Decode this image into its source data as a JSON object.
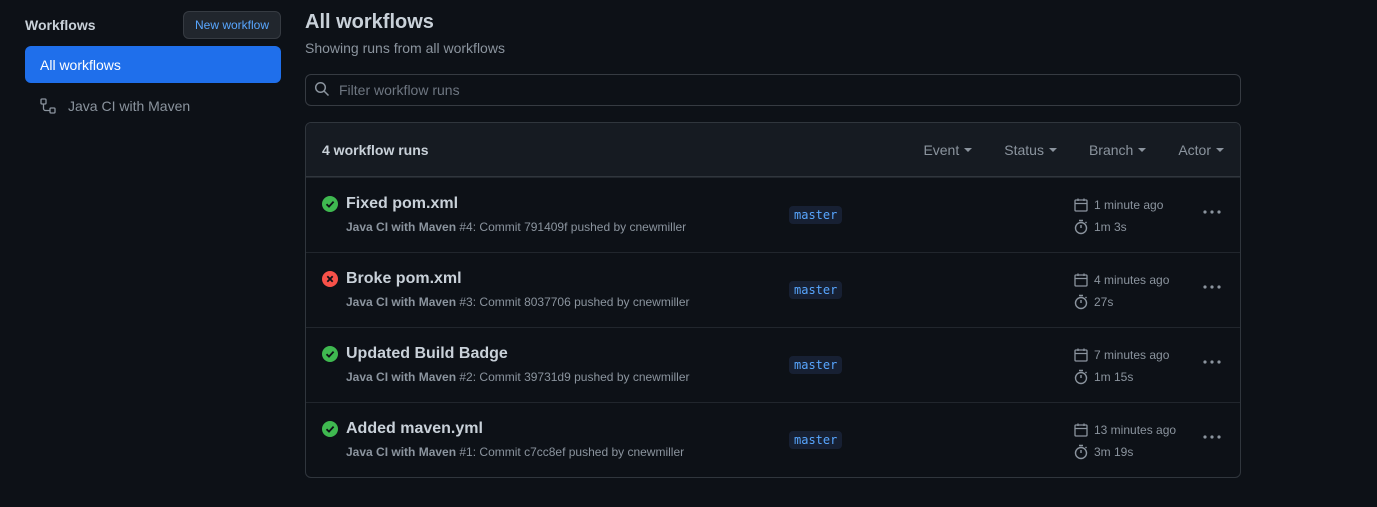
{
  "sidebar": {
    "title": "Workflows",
    "new_button": "New workflow",
    "items": [
      {
        "label": "All workflows"
      },
      {
        "label": "Java CI with Maven"
      }
    ]
  },
  "main": {
    "title": "All workflows",
    "subtitle": "Showing runs from all workflows",
    "filter_placeholder": "Filter workflow runs",
    "count_label": "4 workflow runs",
    "filters": [
      "Event",
      "Status",
      "Branch",
      "Actor"
    ],
    "runs": [
      {
        "status": "success",
        "title": "Fixed pom.xml",
        "workflow": "Java CI with Maven",
        "meta": " #4: Commit 791409f pushed by cnewmiller",
        "branch": "master",
        "when": "1 minute ago",
        "duration": "1m 3s"
      },
      {
        "status": "failure",
        "title": "Broke pom.xml",
        "workflow": "Java CI with Maven",
        "meta": " #3: Commit 8037706 pushed by cnewmiller",
        "branch": "master",
        "when": "4 minutes ago",
        "duration": "27s"
      },
      {
        "status": "success",
        "title": "Updated Build Badge",
        "workflow": "Java CI with Maven",
        "meta": " #2: Commit 39731d9 pushed by cnewmiller",
        "branch": "master",
        "when": "7 minutes ago",
        "duration": "1m 15s"
      },
      {
        "status": "success",
        "title": "Added maven.yml",
        "workflow": "Java CI with Maven",
        "meta": " #1: Commit c7cc8ef pushed by cnewmiller",
        "branch": "master",
        "when": "13 minutes ago",
        "duration": "3m 19s"
      }
    ]
  },
  "colors": {
    "success": "#3fb950",
    "failure": "#f85149",
    "accent": "#1f6feb",
    "link": "#58a6ff"
  }
}
